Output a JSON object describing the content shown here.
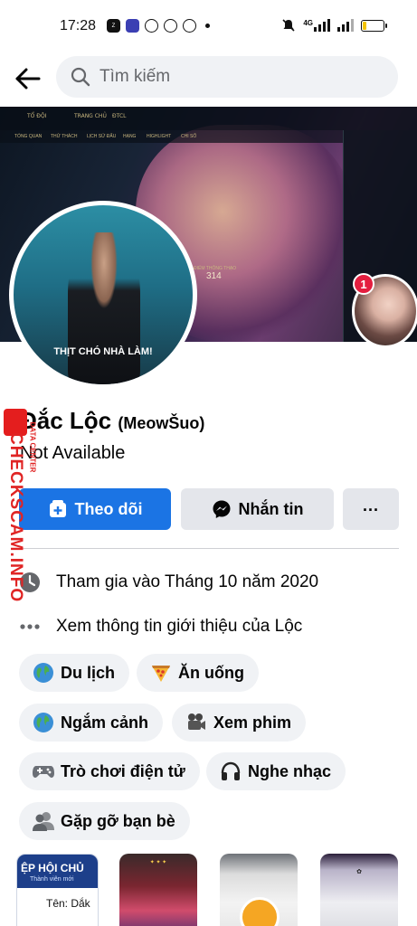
{
  "status_bar": {
    "time": "17:28",
    "app_icons": [
      "zalo-icon",
      "app-icon",
      "messenger-icon",
      "coin-icon",
      "sync-icon"
    ],
    "network": "4G",
    "battery_level": 0.18,
    "battery_color": "#f4c400"
  },
  "header": {
    "search_placeholder": "Tìm kiếm"
  },
  "cover": {
    "game_tabs": [
      "TỔ ĐỘI",
      "TRANG CHỦ",
      "ĐTCL"
    ],
    "sub_tabs": [
      "TỔNG QUAN",
      "THỬ THÁCH",
      "LỊCH SỬ ĐẤU",
      "HẠNG",
      "HIGHLIGHT",
      "CHI SỐ"
    ],
    "rank_label": "ĐIỂM THÔNG THẠO",
    "rank_score": "314"
  },
  "profile": {
    "avatar_caption": "THỊT CHÓ NHÀ LÀM!",
    "story_badge_count": "1",
    "name": "Đắc Lộc",
    "alt_name": "(MeowŠuo)",
    "status": "Not Available"
  },
  "actions": {
    "follow_label": "Theo dõi",
    "message_label": "Nhắn tin",
    "more_label": "..."
  },
  "info": {
    "joined": "Tham gia vào Tháng 10 năm 2020",
    "about": "Xem thông tin giới thiệu của Lộc"
  },
  "interests": [
    {
      "label": "Du lịch",
      "icon": "globe-icon"
    },
    {
      "label": "Ăn uống",
      "icon": "pizza-icon"
    },
    {
      "label": "Ngắm cảnh",
      "icon": "globe-icon"
    },
    {
      "label": "Xem phim",
      "icon": "movie-camera-icon"
    },
    {
      "label": "Trò chơi điện tử",
      "icon": "gamepad-icon"
    },
    {
      "label": "Nghe nhạc",
      "icon": "headphones-icon"
    },
    {
      "label": "Gặp gỡ bạn bè",
      "icon": "people-icon"
    }
  ],
  "featured": {
    "card1_title": "ỆP HỘI CHỦ",
    "card1_sub": "Thành viên mới",
    "card1_line": "Tên:  Dắk"
  },
  "watermark": {
    "brand": "CHECKSCAM.INFO",
    "sub": "DATA CENTER"
  },
  "colors": {
    "primary": "#1b74e4",
    "badge": "#e41e3f",
    "watermark": "#e02424"
  }
}
